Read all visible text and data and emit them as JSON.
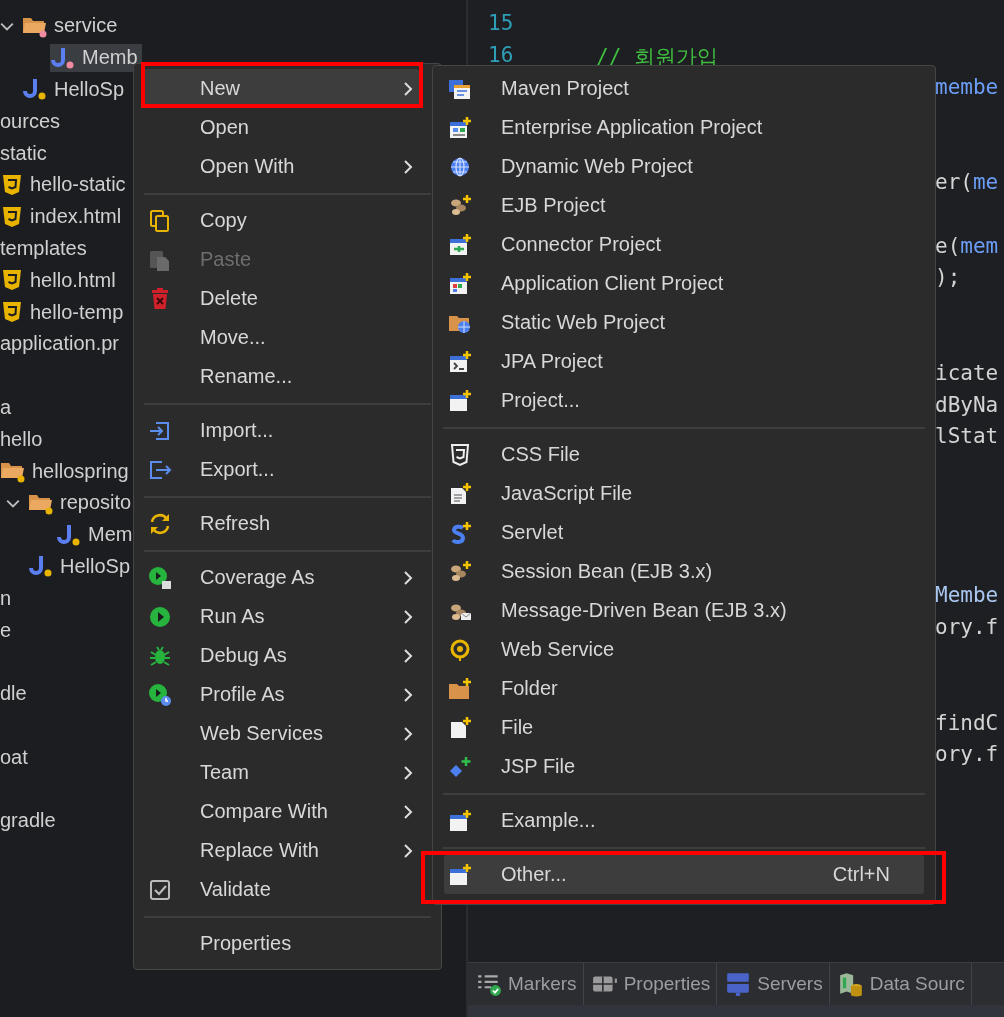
{
  "tree": [
    {
      "label": "service",
      "kind": "folder-unknown",
      "expanded": true,
      "selected": false,
      "children": [
        {
          "label": "Memb",
          "kind": "java-unknown",
          "selected": true
        }
      ]
    },
    {
      "label": "HelloSp",
      "kind": "java",
      "selected": false
    },
    {
      "label": "ources",
      "kind": "cut",
      "selected": false
    },
    {
      "label": "static",
      "kind": "cut",
      "selected": false,
      "children": [
        {
          "label": "hello-static",
          "kind": "html",
          "selected": false
        },
        {
          "label": "index.html",
          "kind": "html",
          "selected": false
        }
      ]
    },
    {
      "label": "templates",
      "kind": "cut",
      "selected": false,
      "children": [
        {
          "label": "hello.html",
          "kind": "html",
          "selected": false
        },
        {
          "label": "hello-temp",
          "kind": "html",
          "selected": false
        }
      ]
    },
    {
      "label": "application.pr",
      "kind": "cut",
      "selected": false
    },
    {
      "label": "a",
      "kind": "cut",
      "selected": false
    },
    {
      "label": "hello",
      "kind": "cut",
      "selected": false,
      "children": [
        {
          "label": "hellospring",
          "kind": "folder",
          "selected": false,
          "children": [
            {
              "label": "reposito",
              "kind": "folder",
              "expanded": true,
              "selected": false,
              "children": [
                {
                  "label": "Mem",
                  "kind": "java",
                  "selected": false
                }
              ]
            },
            {
              "label": "HelloSp",
              "kind": "java",
              "selected": false
            }
          ]
        }
      ]
    },
    {
      "label": "n",
      "kind": "cut",
      "selected": false
    },
    {
      "label": "e",
      "kind": "cut",
      "selected": false
    },
    {
      "label": "dle",
      "kind": "cut",
      "selected": false
    },
    {
      "label": "oat",
      "kind": "cut",
      "selected": false
    },
    {
      "label": "gradle",
      "kind": "cut",
      "selected": false
    }
  ],
  "editor": {
    "lines": [
      {
        "number": "15"
      },
      {
        "number": "16",
        "kind": "full",
        "parts": [
          {
            "text": "// 회원가입",
            "kind": "comment"
          }
        ]
      },
      {
        "kind": "fragment",
        "parts": [
          {
            "text": "membe",
            "kind": "field"
          }
        ]
      },
      {
        "kind": "fragment",
        "parts": [
          {
            "text": "er(",
            "kind": "plain"
          },
          {
            "text": "me",
            "kind": "field"
          }
        ]
      },
      {
        "kind": "fragment",
        "parts": [
          {
            "text": "e(",
            "kind": "plain"
          },
          {
            "text": "mem",
            "kind": "field"
          }
        ]
      },
      {
        "kind": "fragment",
        "parts": [
          {
            "text": ");",
            "kind": "plain"
          }
        ]
      },
      {
        "kind": "fragment",
        "parts": [
          {
            "text": "icate",
            "kind": "plain"
          }
        ]
      },
      {
        "kind": "fragment",
        "parts": [
          {
            "text": "dByNa",
            "kind": "plain"
          }
        ]
      },
      {
        "kind": "fragment",
        "parts": [
          {
            "text": "lStat",
            "kind": "plain"
          }
        ]
      },
      {
        "kind": "fragment",
        "parts": [
          {
            "text": "Membe",
            "kind": "type"
          }
        ]
      },
      {
        "kind": "fragment",
        "parts": [
          {
            "text": "ory.f",
            "kind": "plain"
          }
        ]
      },
      {
        "kind": "fragment",
        "parts": [
          {
            "text": "findC",
            "kind": "plain"
          }
        ]
      },
      {
        "kind": "fragment",
        "parts": [
          {
            "text": "ory.f",
            "kind": "plain"
          }
        ]
      }
    ]
  },
  "views": [
    {
      "label": "Markers"
    },
    {
      "label": "Properties"
    },
    {
      "label": "Servers"
    },
    {
      "label": "Data Sourc"
    }
  ],
  "context_menu": {
    "items": [
      {
        "kind": "item",
        "label": "New",
        "submenu": true,
        "disabled": false,
        "highlighted": true
      },
      {
        "kind": "item",
        "label": "Open",
        "submenu": false,
        "disabled": false,
        "highlighted": false
      },
      {
        "kind": "item",
        "label": "Open With",
        "submenu": true,
        "disabled": false,
        "highlighted": false
      },
      {
        "kind": "separator"
      },
      {
        "kind": "item",
        "label": "Copy",
        "submenu": false,
        "disabled": false,
        "highlighted": false
      },
      {
        "kind": "item",
        "label": "Paste",
        "submenu": false,
        "disabled": true,
        "highlighted": false
      },
      {
        "kind": "item",
        "label": "Delete",
        "submenu": false,
        "disabled": false,
        "highlighted": false
      },
      {
        "kind": "item",
        "label": "Move...",
        "submenu": false,
        "disabled": false,
        "highlighted": false
      },
      {
        "kind": "item",
        "label": "Rename...",
        "submenu": false,
        "disabled": false,
        "highlighted": false
      },
      {
        "kind": "separator"
      },
      {
        "kind": "item",
        "label": "Import...",
        "submenu": false,
        "disabled": false,
        "highlighted": false
      },
      {
        "kind": "item",
        "label": "Export...",
        "submenu": false,
        "disabled": false,
        "highlighted": false
      },
      {
        "kind": "separator"
      },
      {
        "kind": "item",
        "label": "Refresh",
        "submenu": false,
        "disabled": false,
        "highlighted": false
      },
      {
        "kind": "separator"
      },
      {
        "kind": "item",
        "label": "Coverage As",
        "submenu": true,
        "disabled": false,
        "highlighted": false
      },
      {
        "kind": "item",
        "label": "Run As",
        "submenu": true,
        "disabled": false,
        "highlighted": false
      },
      {
        "kind": "item",
        "label": "Debug As",
        "submenu": true,
        "disabled": false,
        "highlighted": false
      },
      {
        "kind": "item",
        "label": "Profile As",
        "submenu": true,
        "disabled": false,
        "highlighted": false
      },
      {
        "kind": "item",
        "label": "Web Services",
        "submenu": true,
        "disabled": false,
        "highlighted": false
      },
      {
        "kind": "item",
        "label": "Team",
        "submenu": true,
        "disabled": false,
        "highlighted": false
      },
      {
        "kind": "item",
        "label": "Compare With",
        "submenu": true,
        "disabled": false,
        "highlighted": false
      },
      {
        "kind": "item",
        "label": "Replace With",
        "submenu": true,
        "disabled": false,
        "highlighted": false
      },
      {
        "kind": "item",
        "label": "Validate",
        "submenu": false,
        "disabled": false,
        "highlighted": false
      },
      {
        "kind": "separator"
      },
      {
        "kind": "item",
        "label": "Properties",
        "submenu": false,
        "disabled": false,
        "highlighted": false
      }
    ]
  },
  "new_submenu": {
    "items": [
      {
        "kind": "item",
        "label": "Maven Project",
        "highlighted": false
      },
      {
        "kind": "item",
        "label": "Enterprise Application Project",
        "highlighted": false
      },
      {
        "kind": "item",
        "label": "Dynamic Web Project",
        "highlighted": false
      },
      {
        "kind": "item",
        "label": "EJB Project",
        "highlighted": false
      },
      {
        "kind": "item",
        "label": "Connector Project",
        "highlighted": false
      },
      {
        "kind": "item",
        "label": "Application Client Project",
        "highlighted": false
      },
      {
        "kind": "item",
        "label": "Static Web Project",
        "highlighted": false
      },
      {
        "kind": "item",
        "label": "JPA Project",
        "highlighted": false
      },
      {
        "kind": "item",
        "label": "Project...",
        "highlighted": false
      },
      {
        "kind": "separator"
      },
      {
        "kind": "item",
        "label": "CSS File",
        "highlighted": false
      },
      {
        "kind": "item",
        "label": "JavaScript File",
        "highlighted": false
      },
      {
        "kind": "item",
        "label": "Servlet",
        "highlighted": false
      },
      {
        "kind": "item",
        "label": "Session Bean (EJB 3.x)",
        "highlighted": false
      },
      {
        "kind": "item",
        "label": "Message-Driven Bean (EJB 3.x)",
        "highlighted": false
      },
      {
        "kind": "item",
        "label": "Web Service",
        "highlighted": false
      },
      {
        "kind": "item",
        "label": "Folder",
        "highlighted": false
      },
      {
        "kind": "item",
        "label": "File",
        "highlighted": false
      },
      {
        "kind": "item",
        "label": "JSP File",
        "highlighted": false
      },
      {
        "kind": "separator"
      },
      {
        "kind": "item",
        "label": "Example...",
        "highlighted": false
      },
      {
        "kind": "separator"
      },
      {
        "kind": "item",
        "label": "Other...",
        "shortcut": "Ctrl+N",
        "highlighted": true
      }
    ]
  }
}
